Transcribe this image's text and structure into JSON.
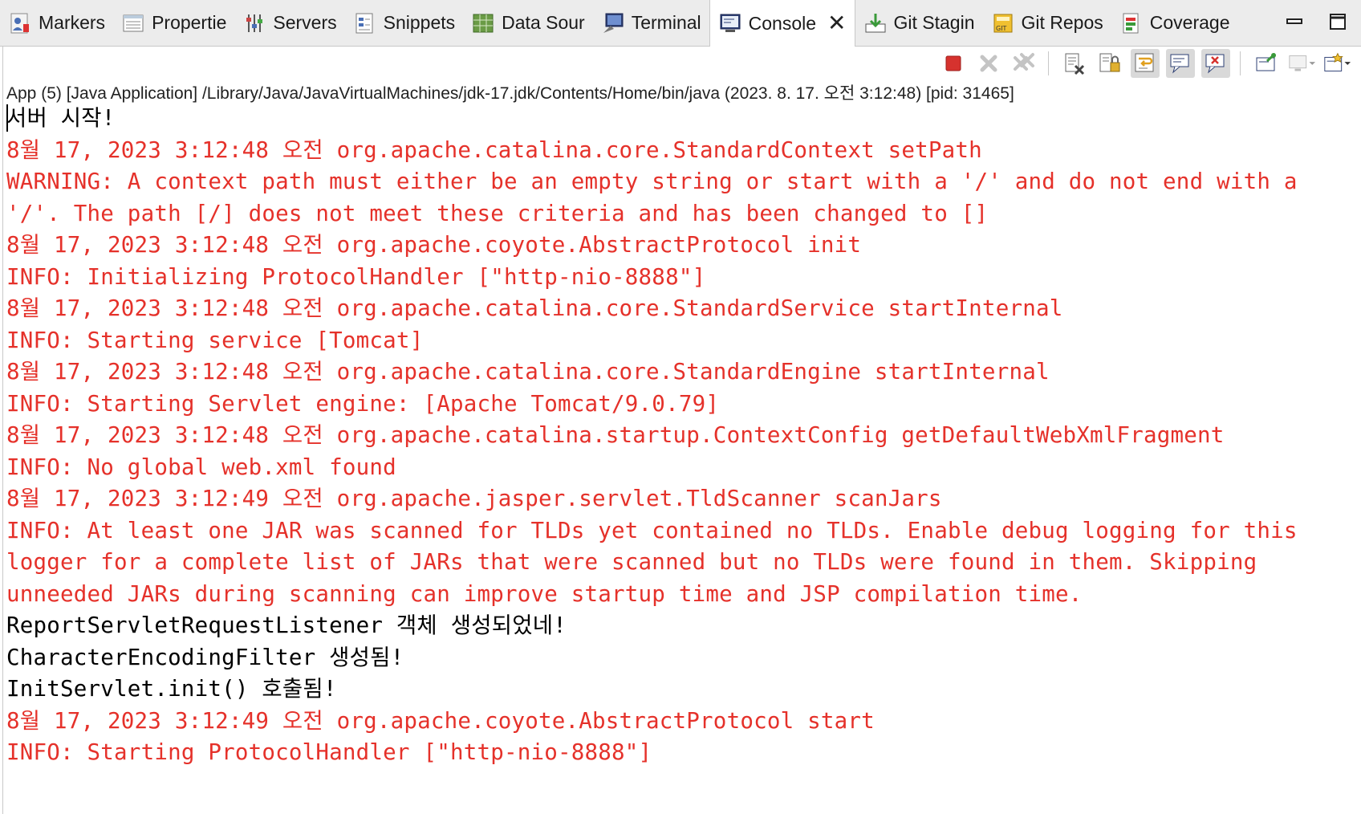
{
  "tabs": [
    {
      "label": "Markers",
      "icon": "markers-icon"
    },
    {
      "label": "Propertie",
      "icon": "properties-icon"
    },
    {
      "label": "Servers",
      "icon": "servers-icon"
    },
    {
      "label": "Snippets",
      "icon": "snippets-icon"
    },
    {
      "label": "Data Sour",
      "icon": "data-source-icon"
    },
    {
      "label": "Terminal",
      "icon": "terminal-icon"
    },
    {
      "label": "Console",
      "icon": "console-icon",
      "active": true
    },
    {
      "label": "Git Stagin",
      "icon": "git-staging-icon"
    },
    {
      "label": "Git Repos",
      "icon": "git-repos-icon"
    },
    {
      "label": "Coverage",
      "icon": "coverage-icon"
    }
  ],
  "toolbar": {
    "icons": [
      "terminate-icon",
      "remove-launch-icon",
      "remove-all-terminated-icon",
      "clear-console-icon",
      "scroll-lock-icon",
      "word-wrap-icon",
      "show-on-stdout-icon",
      "show-on-stderr-icon",
      "pin-console-icon",
      "display-selected-console-icon",
      "open-console-icon"
    ]
  },
  "process_line": "App (5) [Java Application] /Library/Java/JavaVirtualMachines/jdk-17.jdk/Contents/Home/bin/java  (2023. 8. 17. 오전 3:12:48) [pid: 31465]",
  "console": {
    "lines": [
      {
        "text": "서버 시작!",
        "stream": "out"
      },
      {
        "text": "8월 17, 2023 3:12:48 오전 org.apache.catalina.core.StandardContext setPath",
        "stream": "err"
      },
      {
        "text": "WARNING: A context path must either be an empty string or start with a '/' and do not end with a '/'. The path [/] does not meet these criteria and has been changed to []",
        "stream": "err"
      },
      {
        "text": "8월 17, 2023 3:12:48 오전 org.apache.coyote.AbstractProtocol init",
        "stream": "err"
      },
      {
        "text": "INFO: Initializing ProtocolHandler [\"http-nio-8888\"]",
        "stream": "err"
      },
      {
        "text": "8월 17, 2023 3:12:48 오전 org.apache.catalina.core.StandardService startInternal",
        "stream": "err"
      },
      {
        "text": "INFO: Starting service [Tomcat]",
        "stream": "err"
      },
      {
        "text": "8월 17, 2023 3:12:48 오전 org.apache.catalina.core.StandardEngine startInternal",
        "stream": "err"
      },
      {
        "text": "INFO: Starting Servlet engine: [Apache Tomcat/9.0.79]",
        "stream": "err"
      },
      {
        "text": "8월 17, 2023 3:12:48 오전 org.apache.catalina.startup.ContextConfig getDefaultWebXmlFragment",
        "stream": "err"
      },
      {
        "text": "INFO: No global web.xml found",
        "stream": "err"
      },
      {
        "text": "8월 17, 2023 3:12:49 오전 org.apache.jasper.servlet.TldScanner scanJars",
        "stream": "err"
      },
      {
        "text": "INFO: At least one JAR was scanned for TLDs yet contained no TLDs. Enable debug logging for this logger for a complete list of JARs that were scanned but no TLDs were found in them. Skipping unneeded JARs during scanning can improve startup time and JSP compilation time.",
        "stream": "err"
      },
      {
        "text": "ReportServletRequestListener 객체 생성되었네!",
        "stream": "out"
      },
      {
        "text": "CharacterEncodingFilter 생성됨!",
        "stream": "out"
      },
      {
        "text": "InitServlet.init() 호출됨!",
        "stream": "out"
      },
      {
        "text": "8월 17, 2023 3:12:49 오전 org.apache.coyote.AbstractProtocol start",
        "stream": "err"
      },
      {
        "text": "INFO: Starting ProtocolHandler [\"http-nio-8888\"]",
        "stream": "err"
      }
    ]
  },
  "colors": {
    "stderr": "#e5312a",
    "stdout": "#000000",
    "terminate": "#d6322e"
  }
}
